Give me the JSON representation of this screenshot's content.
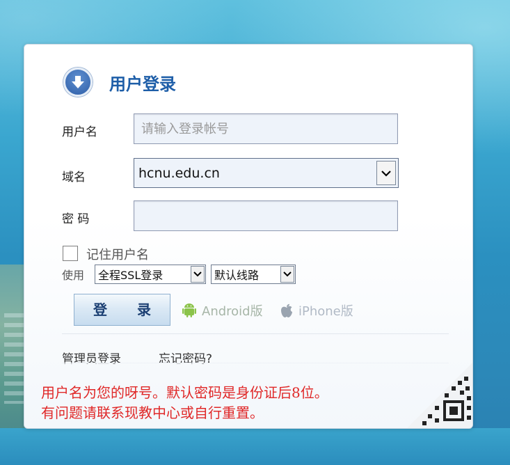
{
  "header": {
    "title": "用户登录",
    "icon": "download-arrow-icon"
  },
  "form": {
    "username_label": "用户名",
    "username_placeholder": "请输入登录帐号",
    "username_value": "",
    "domain_label": "域名",
    "domain_value": "hcnu.edu.cn",
    "password_label": "密 码",
    "password_value": "",
    "remember_label": "记住用户名",
    "remember_checked": false,
    "use_label": "使用",
    "ssl_option": "全程SSL登录",
    "route_option": "默认线路",
    "login_button": "登 录"
  },
  "apps": {
    "android_label": "Android版",
    "android_icon": "android-icon",
    "iphone_label": "iPhone版",
    "iphone_icon": "apple-icon"
  },
  "footer": {
    "admin_login": "管理员登录",
    "forgot_password": "忘记密码?"
  },
  "notice": {
    "line1": "用户名为您的呀号。默认密码是身份证后8位。",
    "line2": "有问题请联系现教中心或自行重置。"
  },
  "colors": {
    "title": "#1e5ea8",
    "notice": "#e02828",
    "android": "#8bc34a",
    "iphone": "#9aa4b0"
  }
}
